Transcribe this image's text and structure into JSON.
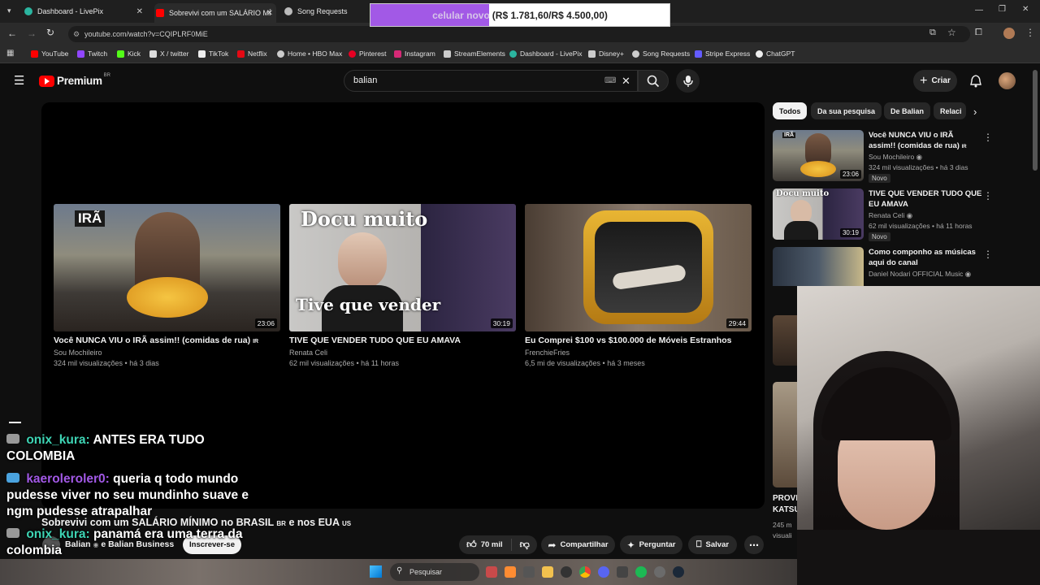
{
  "browser": {
    "tabs": [
      {
        "label": "Dashboard - LivePix",
        "color": "#2bb5a0"
      },
      {
        "label": "Sobrevivi com um SALÁRIO MÍ",
        "color": "#ff0000"
      },
      {
        "label": "Song Requests",
        "color": "#bbbbbb"
      }
    ],
    "url": "youtube.com/watch?v=CQIPLRF0MiE",
    "bookmarks": [
      {
        "label": "YouTube",
        "color": "#ff0000"
      },
      {
        "label": "Twitch",
        "color": "#9146ff"
      },
      {
        "label": "Kick",
        "color": "#53fc18"
      },
      {
        "label": "X / twitter",
        "color": "#ffffff"
      },
      {
        "label": "TikTok",
        "color": "#ffffff"
      },
      {
        "label": "Netflix",
        "color": "#e50914"
      },
      {
        "label": "Home • HBO Max",
        "color": "#cccccc"
      },
      {
        "label": "Pinterest",
        "color": "#e60023"
      },
      {
        "label": "Instagram",
        "color": "#d62976"
      },
      {
        "label": "StreamElements",
        "color": "#cccccc"
      },
      {
        "label": "Dashboard - LivePix",
        "color": "#2bb5a0"
      },
      {
        "label": "Disney+",
        "color": "#cccccc"
      },
      {
        "label": "Song Requests",
        "color": "#cccccc"
      },
      {
        "label": "Stripe Express",
        "color": "#635bff"
      },
      {
        "label": "ChatGPT",
        "color": "#ffffff"
      }
    ]
  },
  "donation": {
    "label": "celular novo",
    "amount": "(R$ 1.781,60/R$ 4.500,00)",
    "progress": 0.396
  },
  "youtube": {
    "logo": "Premium",
    "region": "BR",
    "search_value": "balian",
    "create_label": "Criar",
    "colors": {
      "brand": "#ff0000",
      "bg": "#0f0f0f"
    }
  },
  "endcards": [
    {
      "title": "Você NUNCA VIU o IRÃ assim!! (comidas de rua)",
      "flag": "IR",
      "channel": "Sou Mochileiro",
      "meta": "324 mil visualizações • há 3 dias",
      "duration": "23:06",
      "overlay": "IRÃ"
    },
    {
      "title": "TIVE QUE VENDER TUDO QUE EU AMAVA",
      "flag": "",
      "channel": "Renata Celi",
      "meta": "62 mil visualizações • há 11 horas",
      "duration": "30:19",
      "overlay": "Docu muito",
      "overlay2": "Tive que vender"
    },
    {
      "title": "Eu Comprei $100 vs $100.000 de Móveis Estranhos",
      "flag": "",
      "channel": "FrenchieFries",
      "meta": "6,5 mi de visualizações • há 3 meses",
      "duration": "29:44",
      "overlay": ""
    }
  ],
  "video": {
    "title": "Sobrevivi com um SALÁRIO MÍNIMO no BRASIL",
    "flag1": "BR",
    "mid": "e nos EUA",
    "flag2": "US",
    "channel": "Balian",
    "collab": "e Balian Business",
    "subscribe": "Inscrever-se",
    "likes": "70 mil",
    "share": "Compartilhar",
    "ask": "Perguntar",
    "save": "Salvar"
  },
  "chips": [
    "Todos",
    "Da sua pesquisa",
    "De Balian",
    "Relaci"
  ],
  "sidebar": [
    {
      "title": "Você NUNCA VIU o IRÃ assim!! (comidas de rua)",
      "flag": "IR",
      "channel": "Sou Mochileiro",
      "meta": "324 mil visualizações • há 3 dias",
      "badge": "Novo",
      "duration": "23:06",
      "overlay": "IRÃ"
    },
    {
      "title": "TIVE QUE VENDER TUDO QUE EU AMAVA",
      "channel": "Renata Celi",
      "meta": "62 mil visualizações • há 11 horas",
      "badge": "Novo",
      "duration": "30:19",
      "overlay": "Docu muito"
    },
    {
      "title": "Como componho as músicas aqui do canal",
      "channel": "Daniel Nodari OFFICIAL Music",
      "meta": "",
      "badge": "",
      "duration": "",
      "overlay": ""
    }
  ],
  "sidebar_partial": {
    "title1": "PROVI",
    "title2": "KATSU",
    "meta1": "245 m",
    "meta2": "visuali"
  },
  "chat": [
    {
      "user": "onix_kura:",
      "text": "ANTES ERA TUDO COLOMBIA",
      "color": "#3ed4b4"
    },
    {
      "user": "kaeroleroler0:",
      "text": "queria q todo mundo pudesse viver no seu mundinho suave e ngm pudesse atrapalhar",
      "color": "#a259e6"
    },
    {
      "user": "onix_kura:",
      "text": "panamá era uma terra da colombia",
      "color": "#3ed4b4"
    }
  ],
  "taskbar": {
    "search": "Pesquisar"
  }
}
